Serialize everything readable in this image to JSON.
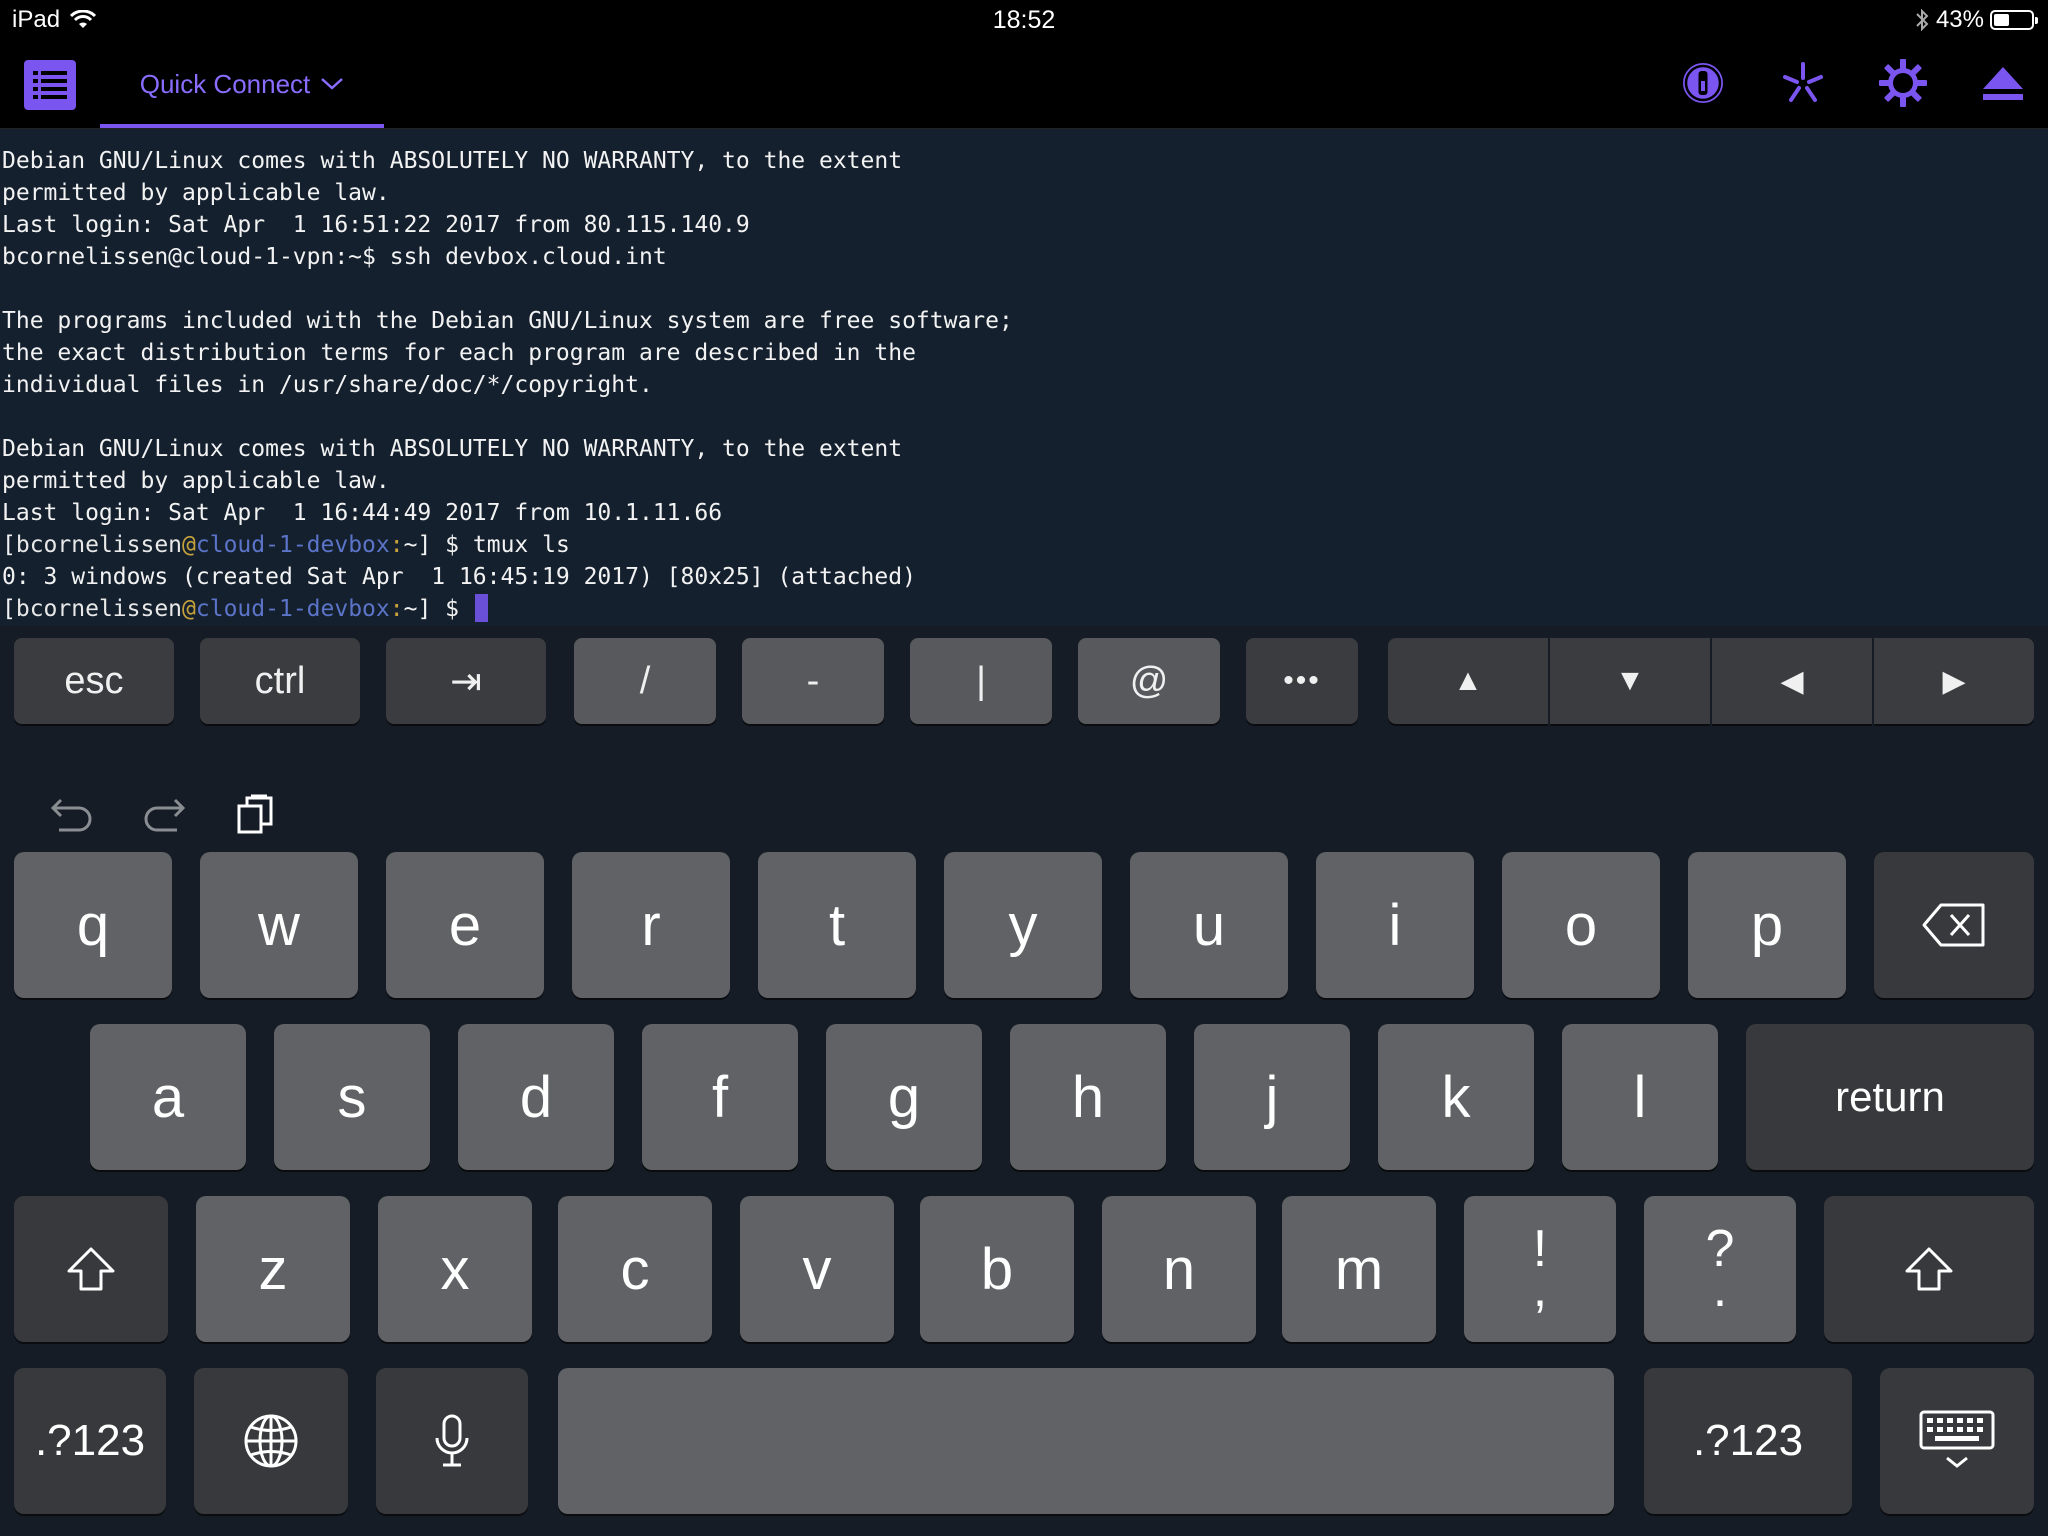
{
  "status_bar": {
    "device": "iPad",
    "time": "18:52",
    "battery_text": "43%",
    "battery_level": 0.43
  },
  "toolbar": {
    "tab_label": "Quick Connect",
    "accent_color": "#7a55f0",
    "icons": [
      "list-menu-icon",
      "one-password-icon",
      "asterisk-icon",
      "gear-icon",
      "eject-icon"
    ]
  },
  "terminal": {
    "lines": [
      "Debian GNU/Linux comes with ABSOLUTELY NO WARRANTY, to the extent",
      "permitted by applicable law.",
      "Last login: Sat Apr  1 16:51:22 2017 from 80.115.140.9",
      "bcornelissen@cloud-1-vpn:~$ ssh devbox.cloud.int",
      "",
      "The programs included with the Debian GNU/Linux system are free software;",
      "the exact distribution terms for each program are described in the",
      "individual files in /usr/share/doc/*/copyright.",
      "",
      "Debian GNU/Linux comes with ABSOLUTELY NO WARRANTY, to the extent",
      "permitted by applicable law.",
      "Last login: Sat Apr  1 16:44:49 2017 from 10.1.11.66"
    ],
    "prompt1": {
      "open": "[",
      "user": "bcornelissen",
      "at": "@",
      "host": "cloud-1-devbox",
      "colon": ":",
      "path": "~",
      "close": "] $ ",
      "command": "tmux ls"
    },
    "output": "0: 3 windows (created Sat Apr  1 16:45:19 2017) [80x25] (attached)",
    "prompt2": {
      "open": "[",
      "user": "bcornelissen",
      "at": "@",
      "host": "cloud-1-devbox",
      "colon": ":",
      "path": "~",
      "close": "] $ "
    }
  },
  "extra_keys": {
    "esc": "esc",
    "ctrl": "ctrl",
    "tab": "⇥",
    "slash": "/",
    "dash": "-",
    "pipe": "|",
    "at": "@",
    "more": "•••",
    "up": "▲",
    "down": "▼",
    "left": "◀",
    "right": "▶"
  },
  "keyboard": {
    "row1": [
      "q",
      "w",
      "e",
      "r",
      "t",
      "y",
      "u",
      "i",
      "o",
      "p"
    ],
    "row2": [
      "a",
      "s",
      "d",
      "f",
      "g",
      "h",
      "j",
      "k",
      "l"
    ],
    "row3": [
      "z",
      "x",
      "c",
      "v",
      "b",
      "n",
      "m"
    ],
    "excl_top": "!",
    "excl_bottom": ",",
    "quest_top": "?",
    "quest_bottom": ".",
    "return": "return",
    "numbers_left": ".?123",
    "numbers_right": ".?123"
  }
}
